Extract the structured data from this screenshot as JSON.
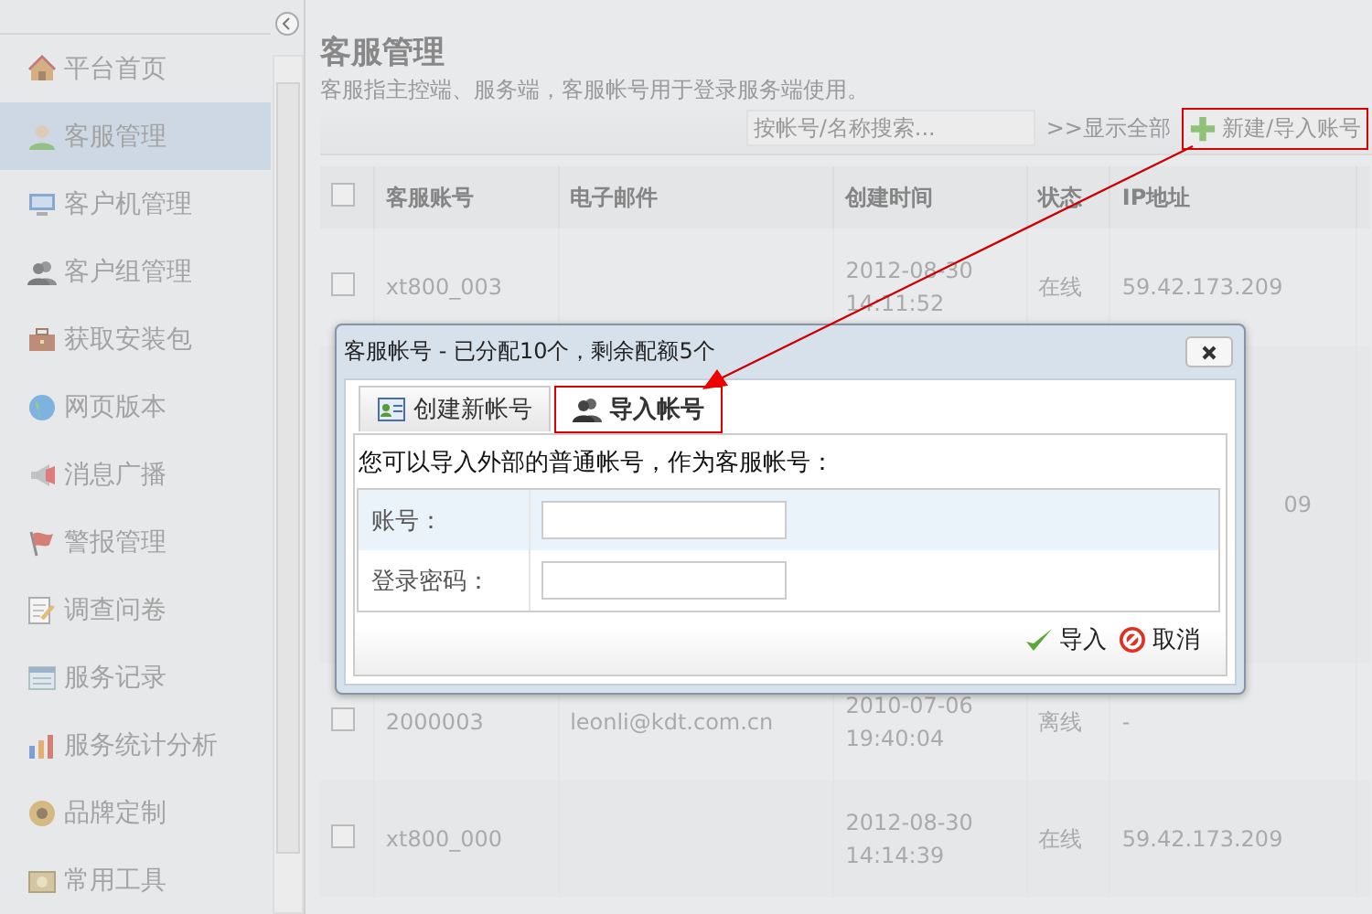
{
  "sidebar": {
    "items": [
      {
        "label": "平台首页",
        "selected": false
      },
      {
        "label": "客服管理",
        "selected": true
      },
      {
        "label": "客户机管理",
        "selected": false
      },
      {
        "label": "客户组管理",
        "selected": false
      },
      {
        "label": "获取安装包",
        "selected": false
      },
      {
        "label": "网页版本",
        "selected": false
      },
      {
        "label": "消息广播",
        "selected": false
      },
      {
        "label": "警报管理",
        "selected": false
      },
      {
        "label": "调查问卷",
        "selected": false
      },
      {
        "label": "服务记录",
        "selected": false
      },
      {
        "label": "服务统计分析",
        "selected": false
      },
      {
        "label": "品牌定制",
        "selected": false
      },
      {
        "label": "常用工具",
        "selected": false
      }
    ]
  },
  "page": {
    "title": "客服管理",
    "subtitle": "客服指主控端、服务端，客服帐号用于登录服务端使用。"
  },
  "toolbar": {
    "search": {
      "placeholder": "按帐号/名称搜索..."
    },
    "show_all": ">>显示全部",
    "new_button": "新建/导入账号"
  },
  "table": {
    "all_checked": false,
    "columns": [
      "客服账号",
      "电子邮件",
      "创建时间",
      "状态",
      "IP地址"
    ],
    "rows": [
      {
        "account": "xt800_003",
        "created": [
          "2012-08-30",
          "14:11:52"
        ],
        "status": "在线",
        "ip": "59.42.173.209",
        "checked": false
      },
      {
        "ip": "09"
      },
      {
        "account": "2000003",
        "email": "leonli@kdt.com.cn",
        "created": [
          "2010-07-06",
          "19:40:04"
        ],
        "status": "离线",
        "ip": "-",
        "checked": false
      },
      {
        "account": "xt800_000",
        "created": [
          "2012-08-30",
          "14:14:39"
        ],
        "status": "在线",
        "ip": "59.42.173.209",
        "checked": false
      }
    ]
  },
  "dialog": {
    "title": "客服帐号 - 已分配10个，剩余配额5个",
    "tabs": [
      {
        "label": "创建新帐号",
        "selected": false
      },
      {
        "label": "导入帐号",
        "selected": true
      }
    ],
    "intro": "您可以导入外部的普通帐号，作为客服帐号：",
    "fields": [
      {
        "label": "账号："
      },
      {
        "label": "登录密码："
      }
    ],
    "buttons": [
      {
        "label": "导入"
      },
      {
        "label": "取消"
      }
    ]
  }
}
